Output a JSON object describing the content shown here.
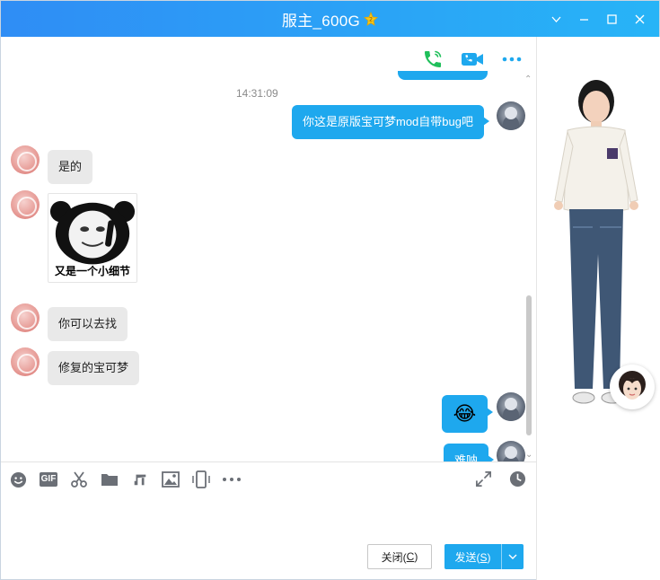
{
  "window": {
    "title": "服主_600G",
    "title_badge_icon": "level-badge-icon",
    "accent_color": "#1ea8ee",
    "controls": [
      "chevron-down-icon",
      "minimize-icon",
      "maximize-icon",
      "close-icon"
    ]
  },
  "chat_header": {
    "actions": [
      "phone-call-icon",
      "video-call-icon",
      "more-icon"
    ]
  },
  "messages": {
    "timestamp": "14:31:09",
    "items": [
      {
        "from": "me",
        "text": "你这是原版宝可梦mod自带bug吧"
      },
      {
        "from": "peer",
        "text": "是的"
      },
      {
        "from": "peer",
        "type": "sticker",
        "caption": "又是一个小细节"
      },
      {
        "from": "peer",
        "text": "你可以去找"
      },
      {
        "from": "peer",
        "text": "修复的宝可梦"
      },
      {
        "from": "me",
        "type": "emoji",
        "emoji": "😂"
      },
      {
        "from": "me",
        "text": "难呐"
      }
    ]
  },
  "toolbar": {
    "tools": [
      "emoji-icon",
      "gif-icon",
      "scissors-icon",
      "folder-icon",
      "music-icon",
      "image-icon",
      "shake-icon",
      "more-icon"
    ],
    "gif_label": "GIF",
    "right_tools": [
      "expand-icon",
      "history-clock-icon"
    ]
  },
  "buttons": {
    "close_label": "关闭(",
    "close_key": "C",
    "close_suffix": ")",
    "send_label": "发送(",
    "send_key": "S",
    "send_suffix": ")"
  }
}
